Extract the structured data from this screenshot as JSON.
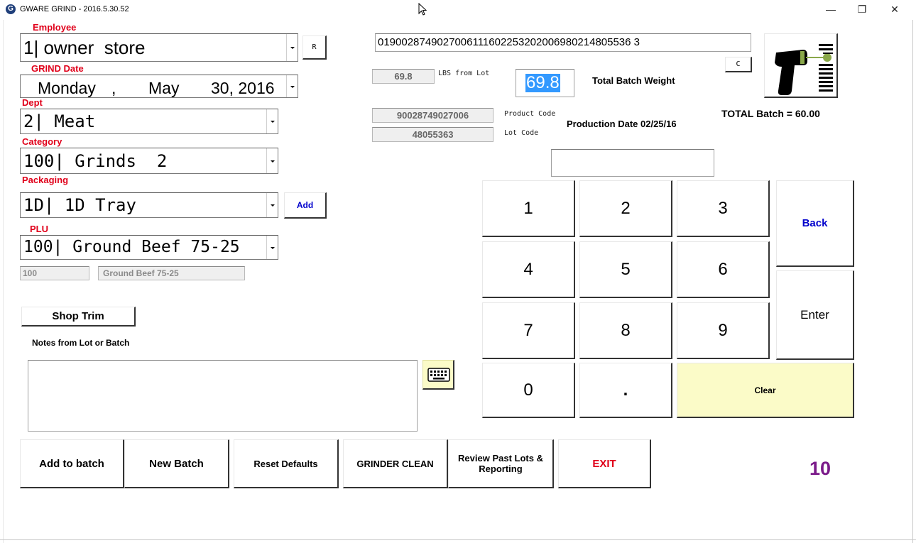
{
  "window": {
    "title": "GWARE GRIND - 2016.5.30.52",
    "app_icon_letter": "G",
    "minimize": "—",
    "restore": "❐",
    "close": "✕"
  },
  "employee": {
    "label": "Employee",
    "value": "1| owner  store",
    "r_button": "R"
  },
  "grind_date": {
    "label": "GRIND Date",
    "weekday": "Monday",
    "comma": ",",
    "month": "May",
    "day_year": "30, 2016"
  },
  "dept": {
    "label": "Dept",
    "value": "2| Meat"
  },
  "category": {
    "label": "Category",
    "value": "100| Grinds  2"
  },
  "packaging": {
    "label": "Packaging",
    "value": "1D| 1D Tray",
    "add_button": "Add"
  },
  "plu": {
    "label": "PLU",
    "value": "100| Ground Beef 75-25",
    "code": "100",
    "name": "Ground Beef 75-25"
  },
  "shop_trim_button": "Shop Trim",
  "notes": {
    "label": "Notes from Lot or Batch",
    "value": ""
  },
  "barcode": {
    "value": "019002874902700611160225320200698021480553630",
    "display": "0190028749027006111602253202006980214805536 3",
    "c_button": "C"
  },
  "lot": {
    "lbs_from_lot_value": "69.8",
    "lbs_from_lot_label": "LBS from Lot",
    "product_code_value": "90028749027006",
    "product_code_label": "Product Code",
    "lot_code_value": "48055363",
    "lot_code_label": "Lot Code",
    "production_date": "Production Date 02/25/16"
  },
  "batch": {
    "weight_value": "69.8",
    "weight_label": "Total Batch Weight",
    "total_label": "TOTAL Batch = 60.00"
  },
  "keypad": {
    "keys": [
      "1",
      "2",
      "3",
      "4",
      "5",
      "6",
      "7",
      "8",
      "9",
      "0",
      "."
    ],
    "back": "Back",
    "enter": "Enter",
    "clear": "Clear",
    "entry_value": ""
  },
  "bottom_buttons": {
    "add_to_batch": "Add to batch",
    "new_batch": "New Batch",
    "reset_defaults": "Reset Defaults",
    "grinder_clean": "GRINDER CLEAN",
    "review_past_lots": "Review Past Lots & Reporting",
    "exit": "EXIT"
  },
  "counter": "10",
  "colors": {
    "label_red": "#e0001a",
    "link_blue": "#0000cc",
    "clear_yellow": "#fbfbc8",
    "counter_purple": "#7b1a8a",
    "weight_highlight": "#3399ff"
  },
  "icons": [
    "scanner-icon",
    "keyboard-icon",
    "cursor-icon"
  ]
}
